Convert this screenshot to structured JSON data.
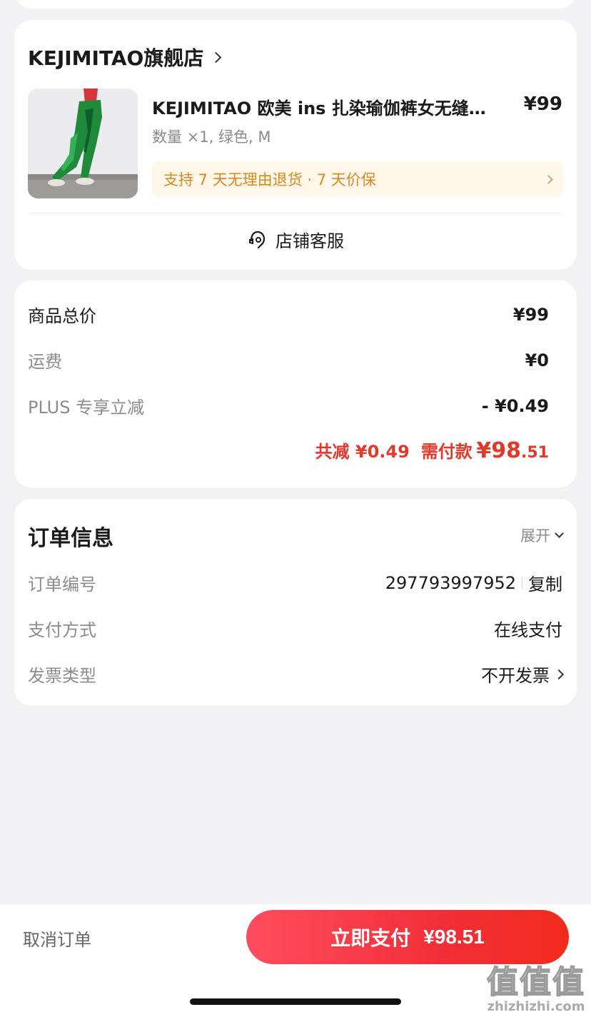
{
  "store": {
    "name": "KEJIMITAO旗舰店",
    "product": {
      "title": "KEJIMITAO 欧美 ins 扎染瑜伽裤女无缝…",
      "price": "¥99",
      "spec": "数量 ×1, 绿色, M",
      "service_badge": "支持 7 天无理由退货 · 7 天价保",
      "image_icon": "green-leggings-photo"
    },
    "customer_service_label": "店铺客服",
    "customer_service_icon": "headset-icon"
  },
  "price_summary": {
    "rows": [
      {
        "label": "商品总价",
        "value": "¥99"
      },
      {
        "label": "运费",
        "value": "¥0"
      },
      {
        "label": "PLUS 专享立减",
        "value": "- ¥0.49"
      }
    ],
    "total_discount_label": "共减",
    "total_discount_value": "¥0.49",
    "amount_due_label": "需付款",
    "amount_due_main": "¥98",
    "amount_due_cents": ".51"
  },
  "order_info": {
    "title": "订单信息",
    "expand_label": "展开",
    "rows": [
      {
        "label": "订单编号",
        "value": "297793997952",
        "action": "复制"
      },
      {
        "label": "支付方式",
        "value": "在线支付"
      },
      {
        "label": "发票类型",
        "value": "不开发票"
      }
    ]
  },
  "bottom_bar": {
    "cancel_label": "取消订单",
    "pay_label": "立即支付",
    "pay_amount": "¥98.51"
  },
  "watermark": {
    "big": "值值值",
    "small": "zhizhizhi.com"
  },
  "colors": {
    "accent_red": "#e2392d",
    "service_orange": "#d98a1f",
    "pay_gradient_start": "#ff4d5f",
    "pay_gradient_end": "#f32b1e"
  }
}
